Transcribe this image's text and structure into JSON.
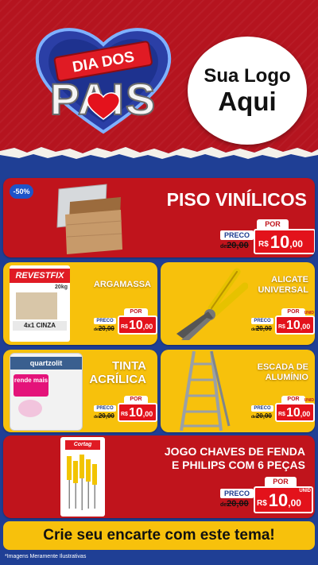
{
  "header": {
    "banner_top": "DIA DOS",
    "banner_main": "PAIS",
    "logo_line1": "Sua Logo",
    "logo_line2": "Aqui"
  },
  "products": [
    {
      "title_lines": [
        "PISO VINÍLICOS"
      ],
      "badge": "-50%",
      "price_label": "PRECO",
      "old_prefix": "de",
      "old_price": "20,00",
      "por": "POR",
      "currency": "R$",
      "price_int": "10",
      "price_dec": ",00",
      "unit": ""
    },
    {
      "title_lines": [
        "ARGAMASSA"
      ],
      "price_label": "PRECO",
      "old_prefix": "de",
      "old_price": "20,00",
      "por": "POR",
      "currency": "R$",
      "price_int": "10",
      "price_dec": ",00",
      "unit": "",
      "product_brand": "REVESTFIX",
      "product_weight": "20kg",
      "product_desc": "4x1 CINZA"
    },
    {
      "title_lines": [
        "ALICATE",
        "UNIVERSAL"
      ],
      "price_label": "PRECO",
      "old_prefix": "de",
      "old_price": "20,00",
      "por": "POR",
      "currency": "R$",
      "price_int": "10",
      "price_dec": ",00",
      "unit": "UNID"
    },
    {
      "title_lines": [
        "TINTA",
        "ACRÍLICA"
      ],
      "price_label": "PRECO",
      "old_prefix": "de",
      "old_price": "20,00",
      "por": "POR",
      "currency": "R$",
      "price_int": "10",
      "price_dec": ",00",
      "unit": "",
      "product_brand": "quartzolit",
      "product_tag": "rende mais"
    },
    {
      "title_lines": [
        "ESCADA DE",
        "ALUMÍNIO"
      ],
      "price_label": "PRECO",
      "old_prefix": "de",
      "old_price": "20,00",
      "por": "POR",
      "currency": "R$",
      "price_int": "10",
      "price_dec": ",00",
      "unit": "UNID"
    },
    {
      "title_lines": [
        "JOGO CHAVES DE FENDA",
        "E PHILIPS COM 6 PEÇAS"
      ],
      "price_label": "PRECO",
      "old_prefix": "de",
      "old_price": "20,00",
      "por": "POR",
      "currency": "R$",
      "price_int": "10",
      "price_dec": ",00",
      "unit": "UNID",
      "product_brand": "Cortag"
    }
  ],
  "footer": {
    "cta": "Crie seu encarte com este tema!",
    "note": "*Imagens Meramente Ilustrativas"
  },
  "colors": {
    "header_red": "#b5141f",
    "card_red": "#c0141c",
    "card_yellow": "#f7c10c",
    "background_blue": "#1f3f95",
    "badge_blue": "#1e54c9"
  }
}
